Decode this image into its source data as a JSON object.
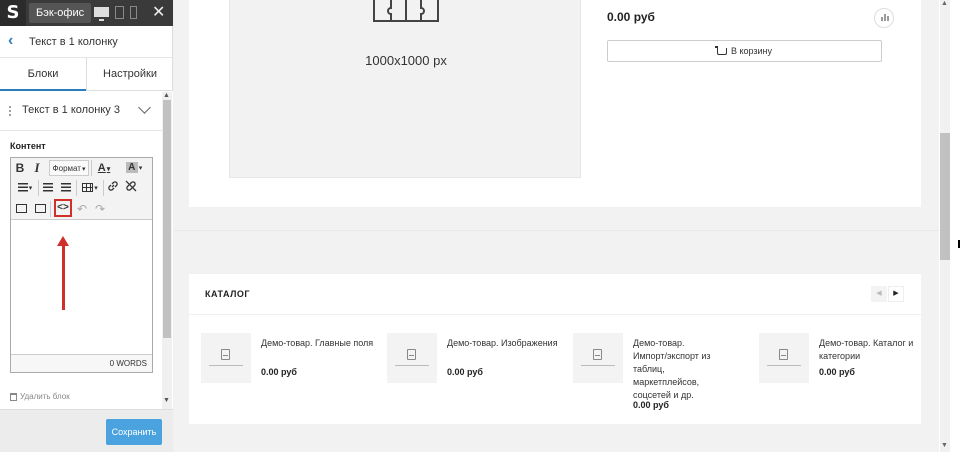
{
  "topbar": {
    "logo": "S",
    "backoffice_label": "Бэк-офис",
    "close_glyph": "✕"
  },
  "panel": {
    "back_glyph": "‹",
    "title": "Текст в 1 колонку",
    "tabs": [
      {
        "label": "Блоки",
        "active": true
      },
      {
        "label": "Настройки",
        "active": false
      }
    ],
    "block_name": "Текст в 1 колонку 3",
    "content_label": "Контент",
    "toolbar": {
      "bold": "B",
      "italic": "I",
      "format": "Формат",
      "text_color": "A",
      "bg_color": "A",
      "source": "<>",
      "undo": "↶",
      "redo": "↷",
      "dropdown": "▾"
    },
    "word_count": "0 WORDS",
    "delete_label": "Удалить блок",
    "save_label": "Сохранить",
    "accent_color": "#4aa3df",
    "highlight_color": "#d0302b"
  },
  "product": {
    "image_size": "1000x1000 px",
    "price": "0.00 руб",
    "cart_label": "В корзину"
  },
  "catalog": {
    "title": "КАТАЛОГ",
    "prev_glyph": "◀",
    "next_glyph": "▶",
    "items": [
      {
        "name": "Демо-товар. Главные поля",
        "price": "0.00 руб"
      },
      {
        "name": "Демо-товар. Изображения",
        "price": "0.00 руб"
      },
      {
        "name": "Демо-товар. Импорт/экспорт из таблиц, маркетплейсов, соцсетей и др.",
        "price": "0.00 руб"
      },
      {
        "name": "Демо-товар. Каталог и категории",
        "price": "0.00 руб"
      }
    ]
  }
}
